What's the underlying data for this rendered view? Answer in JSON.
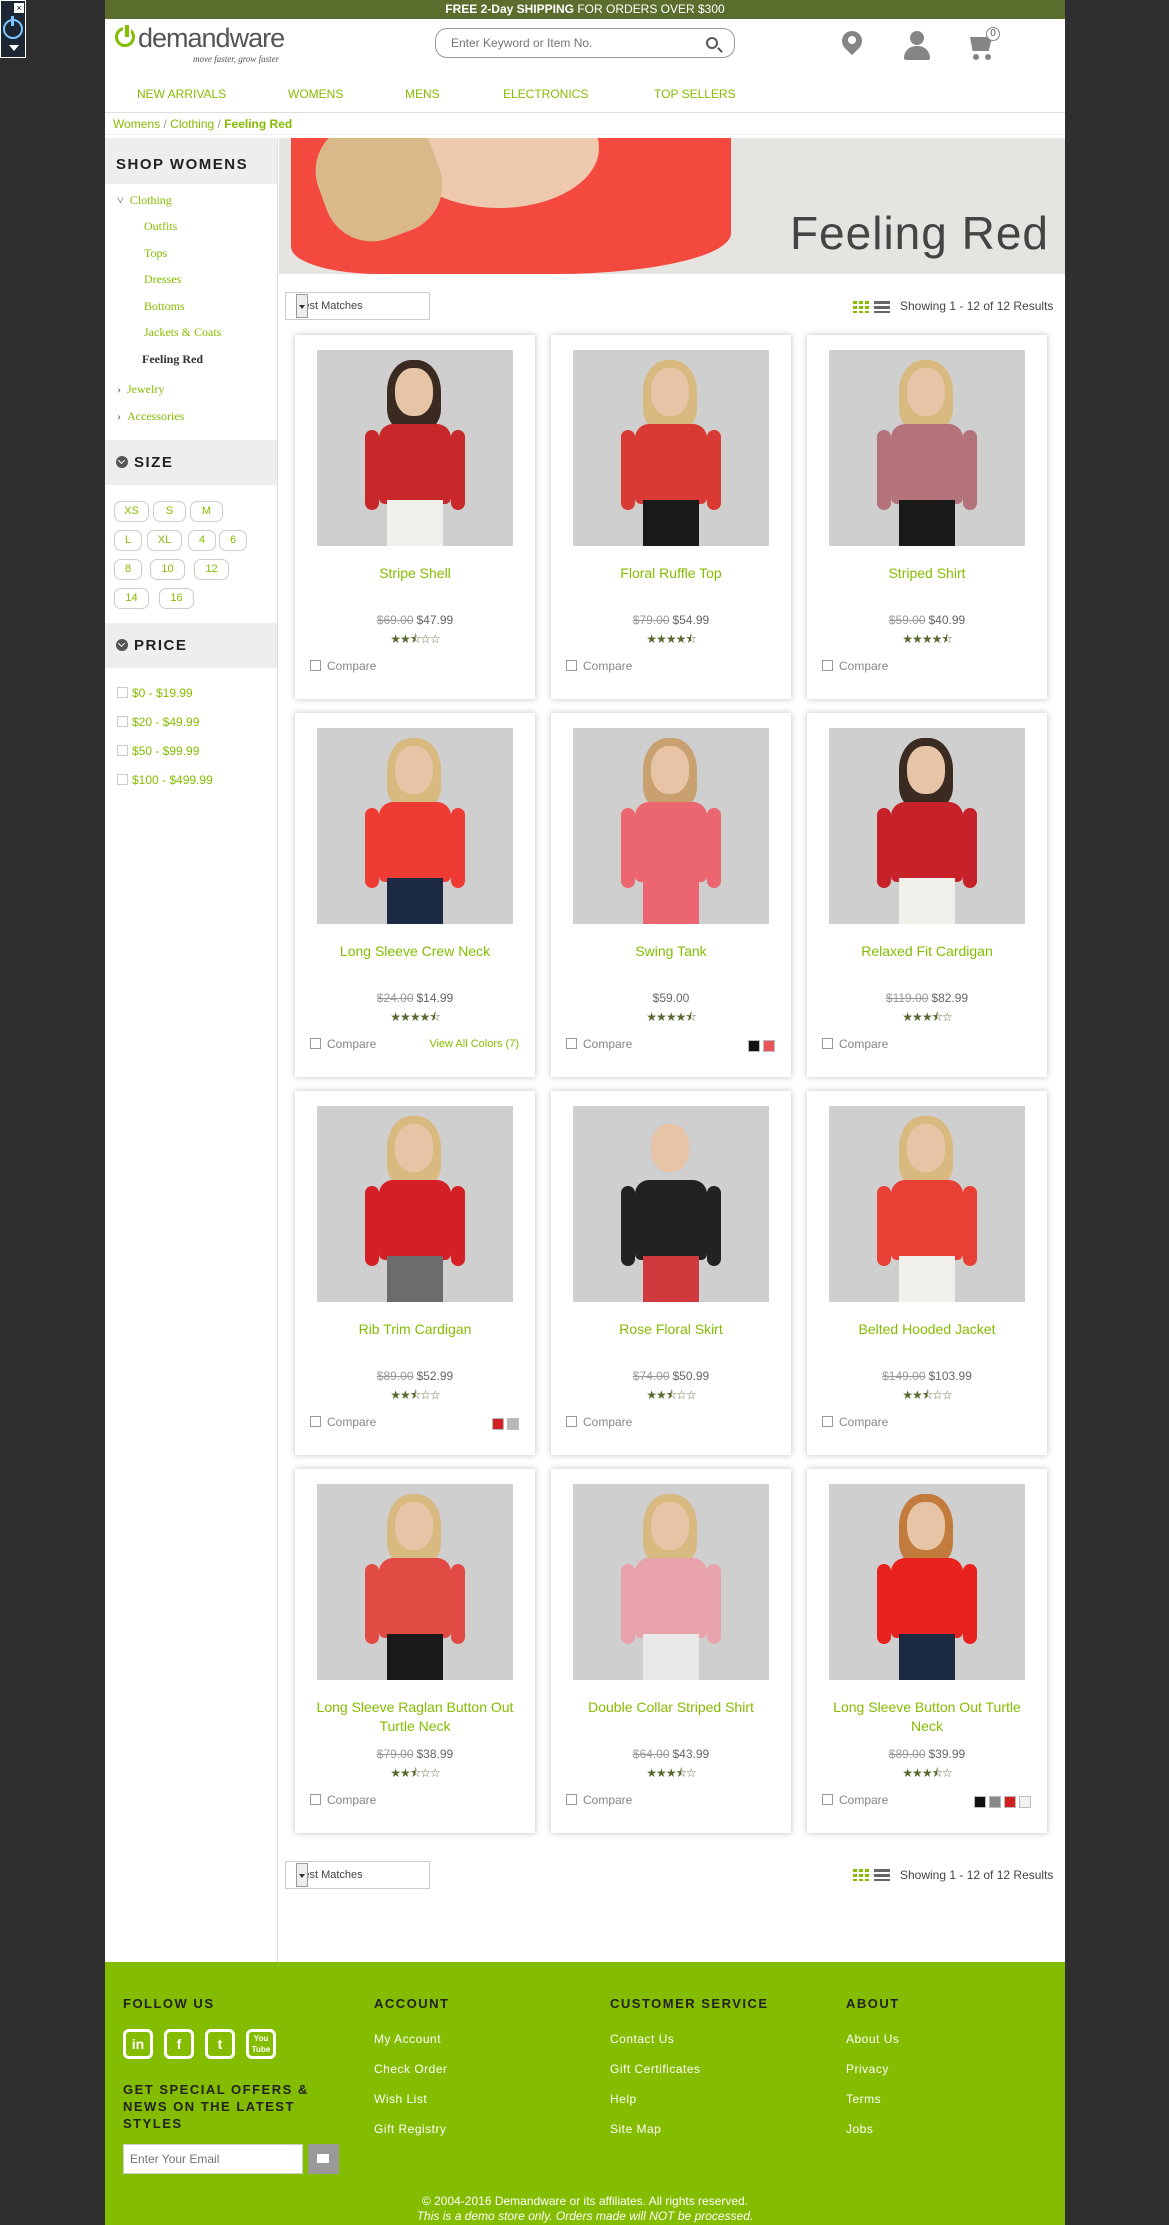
{
  "promo": {
    "bold": "FREE 2-Day SHIPPING",
    "rest": " FOR ORDERS OVER $300"
  },
  "logo": {
    "name": "demandware",
    "tagline": "move faster, grow faster"
  },
  "search": {
    "placeholder": "Enter Keyword or Item No."
  },
  "cart": {
    "count": "0"
  },
  "nav": [
    "NEW ARRIVALS",
    "WOMENS",
    "MENS",
    "ELECTRONICS",
    "TOP SELLERS"
  ],
  "breadcrumb": [
    "Womens",
    "Clothing",
    "Feeling Red"
  ],
  "sidebar": {
    "title": "SHOP WOMENS",
    "clothing": "Clothing",
    "sub": [
      "Outfits",
      "Tops",
      "Dresses",
      "Bottoms",
      "Jackets & Coats",
      "Feeling Red"
    ],
    "other": [
      "Jewelry",
      "Accessories"
    ],
    "size_title": "SIZE",
    "sizes": [
      "XS",
      "S",
      "M",
      "L",
      "XL",
      "4",
      "6",
      "8",
      "10",
      "12",
      "14",
      "16"
    ],
    "price_title": "PRICE",
    "prices": [
      "$0 - $19.99",
      "$20 - $49.99",
      "$50 - $99.99",
      "$100 - $499.99"
    ]
  },
  "banner": {
    "title": "Feeling Red"
  },
  "sort": {
    "selected": "Best Matches"
  },
  "results": "Showing 1 - 12 of 12 Results",
  "compare_label": "Compare",
  "products": [
    {
      "name": "Stripe Shell",
      "old": "$69.00",
      "price": "$47.99",
      "rating": 2.5,
      "view_all": "",
      "swatches": [],
      "color": "#c8282a",
      "legs": "#f2f0ea",
      "hair": "#3a2a20"
    },
    {
      "name": "Floral Ruffle Top",
      "old": "$79.00",
      "price": "$54.99",
      "rating": 4.5,
      "view_all": "",
      "swatches": [],
      "color": "#d93a34",
      "legs": "#1a1a1a",
      "hair": "#d8b97f"
    },
    {
      "name": "Striped Shirt",
      "old": "$59.00",
      "price": "$40.99",
      "rating": 4.5,
      "view_all": "",
      "swatches": [],
      "color": "#b4727a",
      "legs": "#1a1a1a",
      "hair": "#d8b97f"
    },
    {
      "name": "Long Sleeve Crew Neck",
      "old": "$24.00",
      "price": "$14.99",
      "rating": 4.5,
      "view_all": "View All Colors (7)",
      "swatches": [],
      "color": "#ee3c34",
      "legs": "#1d2a44",
      "hair": "#d8b97f"
    },
    {
      "name": "Swing Tank",
      "old": "",
      "price": "$59.00",
      "rating": 4.5,
      "view_all": "",
      "swatches": [
        "#111111",
        "#e8555a"
      ],
      "color": "#ec6670",
      "legs": "#ec6670",
      "hair": "#c9a070"
    },
    {
      "name": "Relaxed Fit Cardigan",
      "old": "$119.00",
      "price": "$82.99",
      "rating": 3.5,
      "view_all": "",
      "swatches": [],
      "color": "#c72229",
      "legs": "#f2f0ea",
      "hair": "#3a2a20"
    },
    {
      "name": "Rib Trim Cardigan",
      "old": "$89.00",
      "price": "$52.99",
      "rating": 2.5,
      "view_all": "",
      "swatches": [
        "#d11f1f",
        "#b9b9b9"
      ],
      "color": "#d51f26",
      "legs": "#6c6c6c",
      "hair": "#d8b97f"
    },
    {
      "name": "Rose Floral Skirt",
      "old": "$74.00",
      "price": "$50.99",
      "rating": 2.5,
      "view_all": "",
      "swatches": [],
      "color": "#222222",
      "legs": "#d13a3c",
      "hair": "#cfcfcf"
    },
    {
      "name": "Belted Hooded Jacket",
      "old": "$149.00",
      "price": "$103.99",
      "rating": 2.5,
      "view_all": "",
      "swatches": [],
      "color": "#e84035",
      "legs": "#f2f0ea",
      "hair": "#d8b97f"
    },
    {
      "name": "Long Sleeve Raglan Button Out Turtle Neck",
      "old": "$79.00",
      "price": "$38.99",
      "rating": 2.5,
      "view_all": "",
      "swatches": [],
      "color": "#e24a44",
      "legs": "#1a1a1a",
      "hair": "#d8b97f"
    },
    {
      "name": "Double Collar Striped Shirt",
      "old": "$64.00",
      "price": "$43.99",
      "rating": 3.5,
      "view_all": "",
      "swatches": [],
      "color": "#e8a3aa",
      "legs": "#e8e8e8",
      "hair": "#d8b97f"
    },
    {
      "name": "Long Sleeve Button Out Turtle Neck",
      "old": "$89.00",
      "price": "$39.99",
      "rating": 3.5,
      "view_all": "",
      "swatches": [
        "#111111",
        "#888888",
        "#d11f1f",
        "#f2f2f2"
      ],
      "color": "#e8221e",
      "legs": "#1d2a44",
      "hair": "#c37a3d"
    }
  ],
  "footer": {
    "follow": "FOLLOW US",
    "social": [
      "in",
      "f",
      "t",
      "You Tube"
    ],
    "offer": "GET SPECIAL OFFERS & NEWS ON THE LATEST STYLES",
    "email_placeholder": "Enter Your Email",
    "cols": [
      {
        "title": "ACCOUNT",
        "links": [
          "My Account",
          "Check Order",
          "Wish List",
          "Gift Registry"
        ]
      },
      {
        "title": "CUSTOMER SERVICE",
        "links": [
          "Contact Us",
          "Gift Certificates",
          "Help",
          "Site Map"
        ]
      },
      {
        "title": "ABOUT",
        "links": [
          "About Us",
          "Privacy",
          "Terms",
          "Jobs"
        ]
      }
    ],
    "copyright": "© 2004-2016 Demandware or its affiliates. All rights reserved.",
    "demo": "This is a demo store only. Orders made will NOT be processed."
  }
}
